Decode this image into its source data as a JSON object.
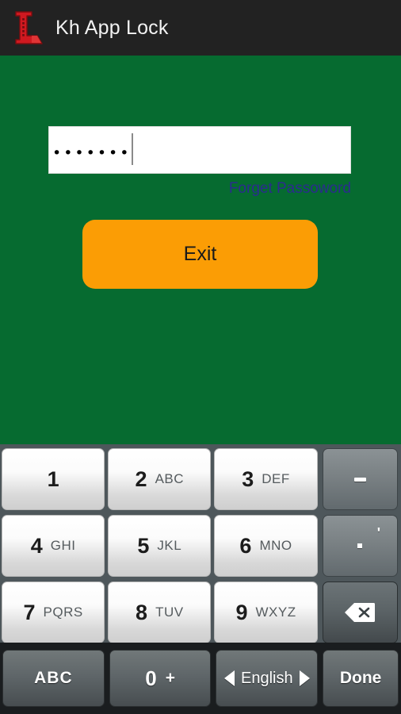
{
  "titlebar": {
    "app_name": "Kh App Lock",
    "logo_icon": "app-lock-letter-l-logo",
    "bg_color": "#222222",
    "logo_color": "#cf1920"
  },
  "screen": {
    "bg_color": "#066b30",
    "password": {
      "masked_value": "•••••••",
      "placeholder": "",
      "char_count": 7,
      "caret_visible": true
    },
    "forget_link": {
      "label": "Forget Passoword",
      "color": "#2b2b8f"
    },
    "exit_button": {
      "label": "Exit",
      "bg_color": "#fb9d05",
      "text_color": "#1a1a1a"
    }
  },
  "keyboard": {
    "bg_color": "#4e575b",
    "bottom_row_bg_color": "#1a1d1f",
    "rows": [
      {
        "keys": [
          {
            "digit": "1",
            "letters": "",
            "type": "light",
            "name": "key-1"
          },
          {
            "digit": "2",
            "letters": "ABC",
            "type": "light",
            "name": "key-2"
          },
          {
            "digit": "3",
            "letters": "DEF",
            "type": "light",
            "name": "key-3"
          },
          {
            "digit": "",
            "letters": "",
            "type": "dark",
            "name": "key-dash",
            "glyph": "dash",
            "label": "-"
          }
        ]
      },
      {
        "keys": [
          {
            "digit": "4",
            "letters": "GHI",
            "type": "light",
            "name": "key-4"
          },
          {
            "digit": "5",
            "letters": "JKL",
            "type": "light",
            "name": "key-5"
          },
          {
            "digit": "6",
            "letters": "MNO",
            "type": "light",
            "name": "key-6"
          },
          {
            "digit": "",
            "letters": "",
            "type": "dark",
            "name": "key-period",
            "glyph": "period",
            "label": ".",
            "hint": "'"
          }
        ]
      },
      {
        "keys": [
          {
            "digit": "7",
            "letters": "PQRS",
            "type": "light",
            "name": "key-7"
          },
          {
            "digit": "8",
            "letters": "TUV",
            "type": "light",
            "name": "key-8"
          },
          {
            "digit": "9",
            "letters": "WXYZ",
            "type": "light",
            "name": "key-9"
          },
          {
            "digit": "",
            "letters": "",
            "type": "darker",
            "name": "key-backspace",
            "glyph": "backspace",
            "label": "Backspace"
          }
        ]
      }
    ],
    "bottom_row": {
      "abc_label": "ABC",
      "zero_label": "0",
      "zero_alt_label": "+",
      "language_label": "English",
      "language_prev_icon": "arrow-left-icon",
      "language_next_icon": "arrow-right-icon",
      "done_label": "Done"
    }
  }
}
